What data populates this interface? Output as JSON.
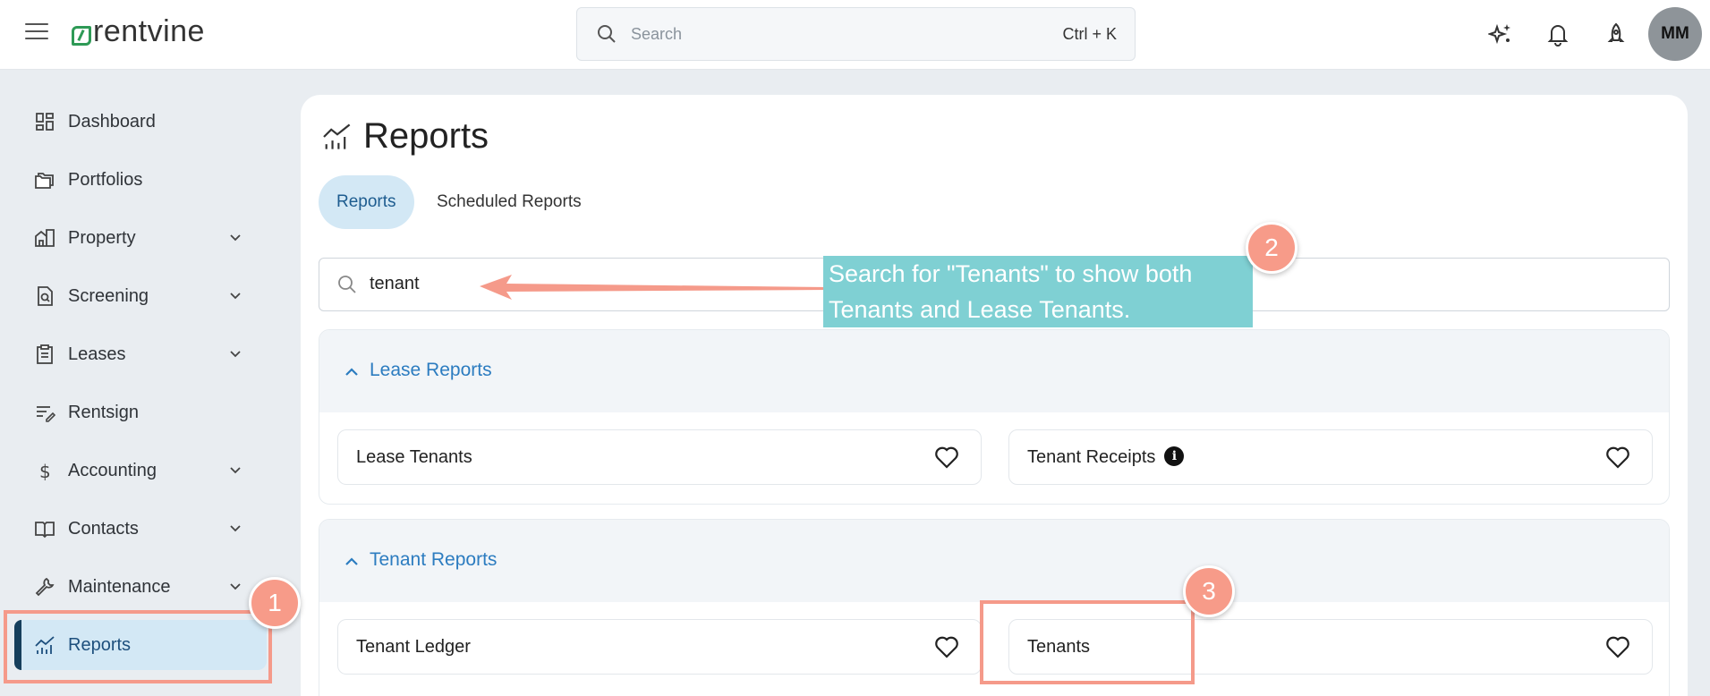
{
  "header": {
    "logo_text": "rentvine",
    "search_placeholder": "Search",
    "search_shortcut": "Ctrl + K",
    "avatar_initials": "MM"
  },
  "sidebar": {
    "items": [
      {
        "label": "Dashboard",
        "icon": "dashboard-icon"
      },
      {
        "label": "Portfolios",
        "icon": "folders-icon"
      },
      {
        "label": "Property",
        "icon": "buildings-icon",
        "expandable": true
      },
      {
        "label": "Screening",
        "icon": "screening-icon",
        "expandable": true
      },
      {
        "label": "Leases",
        "icon": "clipboard-icon",
        "expandable": true
      },
      {
        "label": "Rentsign",
        "icon": "signature-icon"
      },
      {
        "label": "Accounting",
        "icon": "dollar-icon",
        "expandable": true
      },
      {
        "label": "Contacts",
        "icon": "book-icon",
        "expandable": true
      },
      {
        "label": "Maintenance",
        "icon": "wrench-icon",
        "expandable": true
      },
      {
        "label": "Reports",
        "icon": "chart-icon",
        "active": true
      }
    ]
  },
  "main": {
    "title": "Reports",
    "tabs": [
      {
        "label": "Reports",
        "active": true
      },
      {
        "label": "Scheduled Reports",
        "active": false
      }
    ],
    "search_value": "tenant",
    "groups": [
      {
        "title": "Lease Reports",
        "reports": [
          {
            "label": "Lease Tenants",
            "info": false
          },
          {
            "label": "Tenant Receipts",
            "info": true
          }
        ]
      },
      {
        "title": "Tenant Reports",
        "reports": [
          {
            "label": "Tenant Ledger",
            "info": false
          },
          {
            "label": "Tenants",
            "info": false
          }
        ]
      }
    ]
  },
  "annotations": {
    "badge_1": "1",
    "badge_2": "2",
    "badge_3": "3",
    "callout_line1": "Search for \"Tenants\" to show both",
    "callout_line2": "Tenants and Lease Tenants.",
    "accent_color": "#f79b89",
    "callout_color": "#7fd0d3"
  },
  "info_glyph": "i"
}
